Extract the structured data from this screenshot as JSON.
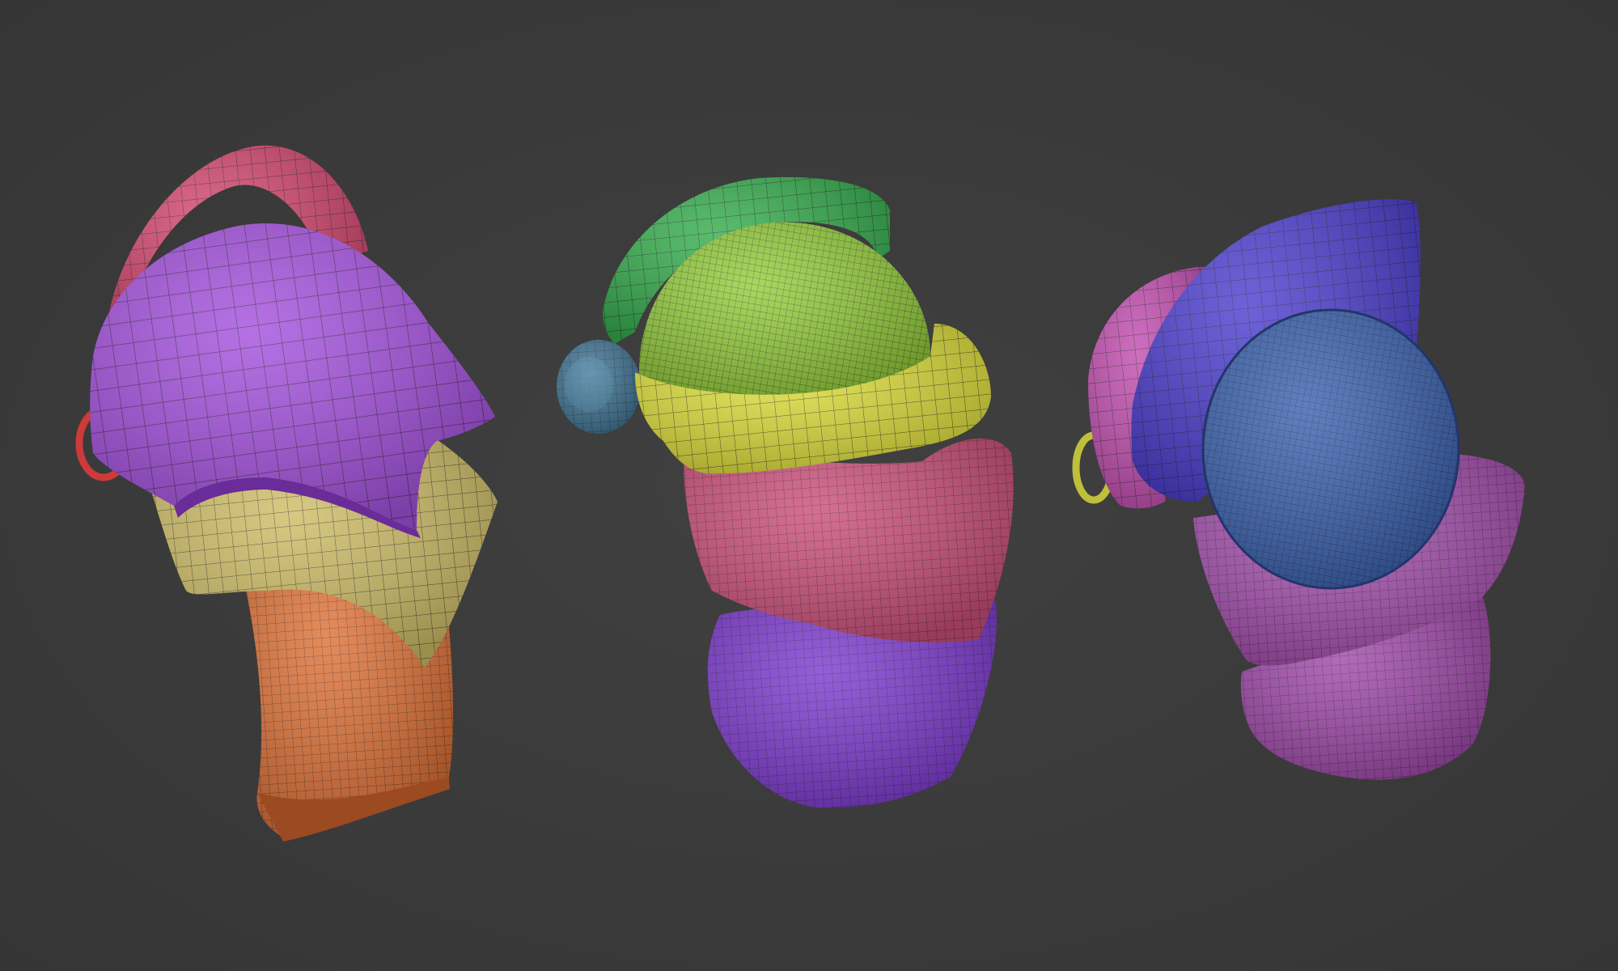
{
  "scene": {
    "background": "#3b3b3b",
    "wire_color": "#1a1a1a",
    "models": [
      {
        "name": "armor-piece-left",
        "parts": [
          {
            "name": "crest-plate",
            "color": "#d2466f"
          },
          {
            "name": "top-plate",
            "color": "#a552de"
          },
          {
            "name": "middle-plate",
            "color": "#cfbd67"
          },
          {
            "name": "lower-plate",
            "color": "#df7238"
          },
          {
            "name": "ring",
            "color": "#cc3a3a"
          }
        ]
      },
      {
        "name": "armor-piece-center",
        "parts": [
          {
            "name": "crest-plate",
            "color": "#36ad4e"
          },
          {
            "name": "dome",
            "color": "#95ce3c"
          },
          {
            "name": "rim-plate",
            "color": "#ddde3c"
          },
          {
            "name": "knob",
            "color": "#3f7392"
          },
          {
            "name": "middle-plate",
            "color": "#cc507a"
          },
          {
            "name": "lower-plate",
            "color": "#7e3bd0"
          }
        ]
      },
      {
        "name": "armor-piece-right",
        "parts": [
          {
            "name": "back-plate",
            "color": "#c24fb0"
          },
          {
            "name": "front-plate",
            "color": "#4d3fcf"
          },
          {
            "name": "dome",
            "color": "#3c63b2"
          },
          {
            "name": "lower-plate",
            "color": "#a54fae"
          },
          {
            "name": "bottom-plate",
            "color": "#a14aab"
          },
          {
            "name": "ring",
            "color": "#bfbf3a"
          }
        ]
      }
    ]
  }
}
